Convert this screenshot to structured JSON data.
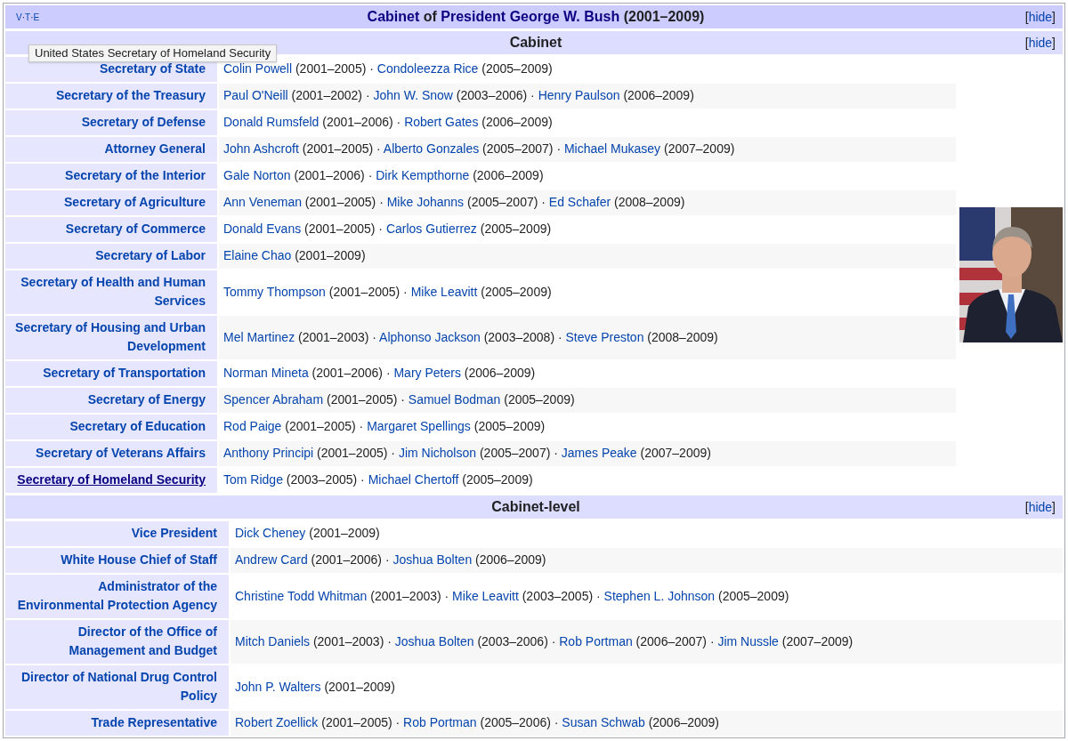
{
  "navbox": {
    "vte": [
      "V",
      "·",
      "T",
      "·",
      "E"
    ],
    "title": [
      {
        "text": "Cabinet",
        "link": true
      },
      {
        "text": " of ",
        "link": false
      },
      {
        "text": "President George W. Bush",
        "link": true
      },
      {
        "text": " (2001–2009)",
        "link": false
      }
    ],
    "toggle": {
      "open": "[",
      "label": "hide",
      "close": "]"
    }
  },
  "tooltip": "United States Secretary of Homeland Security",
  "groups": [
    {
      "title": "Cabinet",
      "toggle": {
        "open": "[",
        "label": "hide",
        "close": "]"
      },
      "rows": [
        {
          "label": "Secretary of State",
          "hovered": false,
          "members": [
            {
              "name": "Colin Powell",
              "years": "(2001–2005) ·"
            },
            {
              "name": "Condoleezza Rice",
              "years": "(2005–2009)"
            }
          ]
        },
        {
          "label": "Secretary of the Treasury",
          "hovered": false,
          "members": [
            {
              "name": "Paul O'Neill",
              "years": "(2001–2002) ·"
            },
            {
              "name": "John W. Snow",
              "years": "(2003–2006) ·"
            },
            {
              "name": "Henry Paulson",
              "years": "(2006–2009)"
            }
          ]
        },
        {
          "label": "Secretary of Defense",
          "hovered": false,
          "members": [
            {
              "name": "Donald Rumsfeld",
              "years": "(2001–2006) ·"
            },
            {
              "name": "Robert Gates",
              "years": "(2006–2009)"
            }
          ]
        },
        {
          "label": "Attorney General",
          "hovered": false,
          "members": [
            {
              "name": "John Ashcroft",
              "years": "(2001–2005) ·"
            },
            {
              "name": "Alberto Gonzales",
              "years": "(2005–2007) ·"
            },
            {
              "name": "Michael Mukasey",
              "years": "(2007–2009)"
            }
          ]
        },
        {
          "label": "Secretary of the Interior",
          "hovered": false,
          "members": [
            {
              "name": "Gale Norton",
              "years": "(2001–2006) ·"
            },
            {
              "name": "Dirk Kempthorne",
              "years": "(2006–2009)"
            }
          ]
        },
        {
          "label": "Secretary of Agriculture",
          "hovered": false,
          "members": [
            {
              "name": "Ann Veneman",
              "years": "(2001–2005) ·"
            },
            {
              "name": "Mike Johanns",
              "years": "(2005–2007) ·"
            },
            {
              "name": "Ed Schafer",
              "years": "(2008–2009)"
            }
          ]
        },
        {
          "label": "Secretary of Commerce",
          "hovered": false,
          "members": [
            {
              "name": "Donald Evans",
              "years": "(2001–2005) ·"
            },
            {
              "name": "Carlos Gutierrez",
              "years": "(2005–2009)"
            }
          ]
        },
        {
          "label": "Secretary of Labor",
          "hovered": false,
          "members": [
            {
              "name": "Elaine Chao",
              "years": "(2001–2009)"
            }
          ]
        },
        {
          "label": "Secretary of Health and Human Services",
          "hovered": false,
          "members": [
            {
              "name": "Tommy Thompson",
              "years": "(2001–2005) ·"
            },
            {
              "name": "Mike Leavitt",
              "years": "(2005–2009)"
            }
          ]
        },
        {
          "label": "Secretary of Housing and Urban Development",
          "hovered": false,
          "members": [
            {
              "name": "Mel Martinez",
              "years": "(2001–2003) ·"
            },
            {
              "name": "Alphonso Jackson",
              "years": "(2003–2008) ·"
            },
            {
              "name": "Steve Preston",
              "years": "(2008–2009)"
            }
          ]
        },
        {
          "label": "Secretary of Transportation",
          "hovered": false,
          "members": [
            {
              "name": "Norman Mineta",
              "years": "(2001–2006) ·"
            },
            {
              "name": "Mary Peters",
              "years": "(2006–2009)"
            }
          ]
        },
        {
          "label": "Secretary of Energy",
          "hovered": false,
          "members": [
            {
              "name": "Spencer Abraham",
              "years": "(2001–2005) ·"
            },
            {
              "name": "Samuel Bodman",
              "years": "(2005–2009)"
            }
          ]
        },
        {
          "label": "Secretary of Education",
          "hovered": false,
          "members": [
            {
              "name": "Rod Paige",
              "years": "(2001–2005) ·"
            },
            {
              "name": "Margaret Spellings",
              "years": "(2005–2009)"
            }
          ]
        },
        {
          "label": "Secretary of Veterans Affairs",
          "hovered": false,
          "members": [
            {
              "name": "Anthony Principi",
              "years": "(2001–2005) ·"
            },
            {
              "name": "Jim Nicholson",
              "years": "(2005–2007) ·"
            },
            {
              "name": "James Peake",
              "years": "(2007–2009)"
            }
          ]
        },
        {
          "label": "Secretary of Homeland Security",
          "hovered": true,
          "members": [
            {
              "name": "Tom Ridge",
              "years": "(2003–2005) ·"
            },
            {
              "name": "Michael Chertoff",
              "years": "(2005–2009)"
            }
          ]
        }
      ]
    },
    {
      "title": "Cabinet-level",
      "toggle": {
        "open": "[",
        "label": "hide",
        "close": "]"
      },
      "rows": [
        {
          "label": "Vice President",
          "hovered": false,
          "members": [
            {
              "name": "Dick Cheney",
              "years": "(2001–2009)"
            }
          ]
        },
        {
          "label": "White House Chief of Staff",
          "hovered": false,
          "members": [
            {
              "name": "Andrew Card",
              "years": "(2001–2006) ·"
            },
            {
              "name": "Joshua Bolten",
              "years": "(2006–2009)"
            }
          ]
        },
        {
          "label": "Administrator of the Environmental Protection Agency",
          "hovered": false,
          "members": [
            {
              "name": "Christine Todd Whitman",
              "years": "(2001–2003) ·"
            },
            {
              "name": "Mike Leavitt",
              "years": "(2003–2005) ·"
            },
            {
              "name": "Stephen L. Johnson",
              "years": "(2005–2009)"
            }
          ]
        },
        {
          "label": "Director of the Office of Management and Budget",
          "hovered": false,
          "members": [
            {
              "name": "Mitch Daniels",
              "years": "(2001–2003) ·"
            },
            {
              "name": "Joshua Bolten",
              "years": "(2003–2006) ·"
            },
            {
              "name": "Rob Portman",
              "years": "(2006–2007) ·"
            },
            {
              "name": "Jim Nussle",
              "years": "(2007–2009)"
            }
          ]
        },
        {
          "label": "Director of National Drug Control Policy",
          "hovered": false,
          "members": [
            {
              "name": "John P. Walters",
              "years": "(2001–2009)"
            }
          ]
        },
        {
          "label": "Trade Representative",
          "hovered": false,
          "members": [
            {
              "name": "Robert Zoellick",
              "years": "(2001–2005) ·"
            },
            {
              "name": "Rob Portman",
              "years": "(2005–2006) ·"
            },
            {
              "name": "Susan Schwab",
              "years": "(2006–2009)"
            }
          ]
        }
      ]
    }
  ]
}
